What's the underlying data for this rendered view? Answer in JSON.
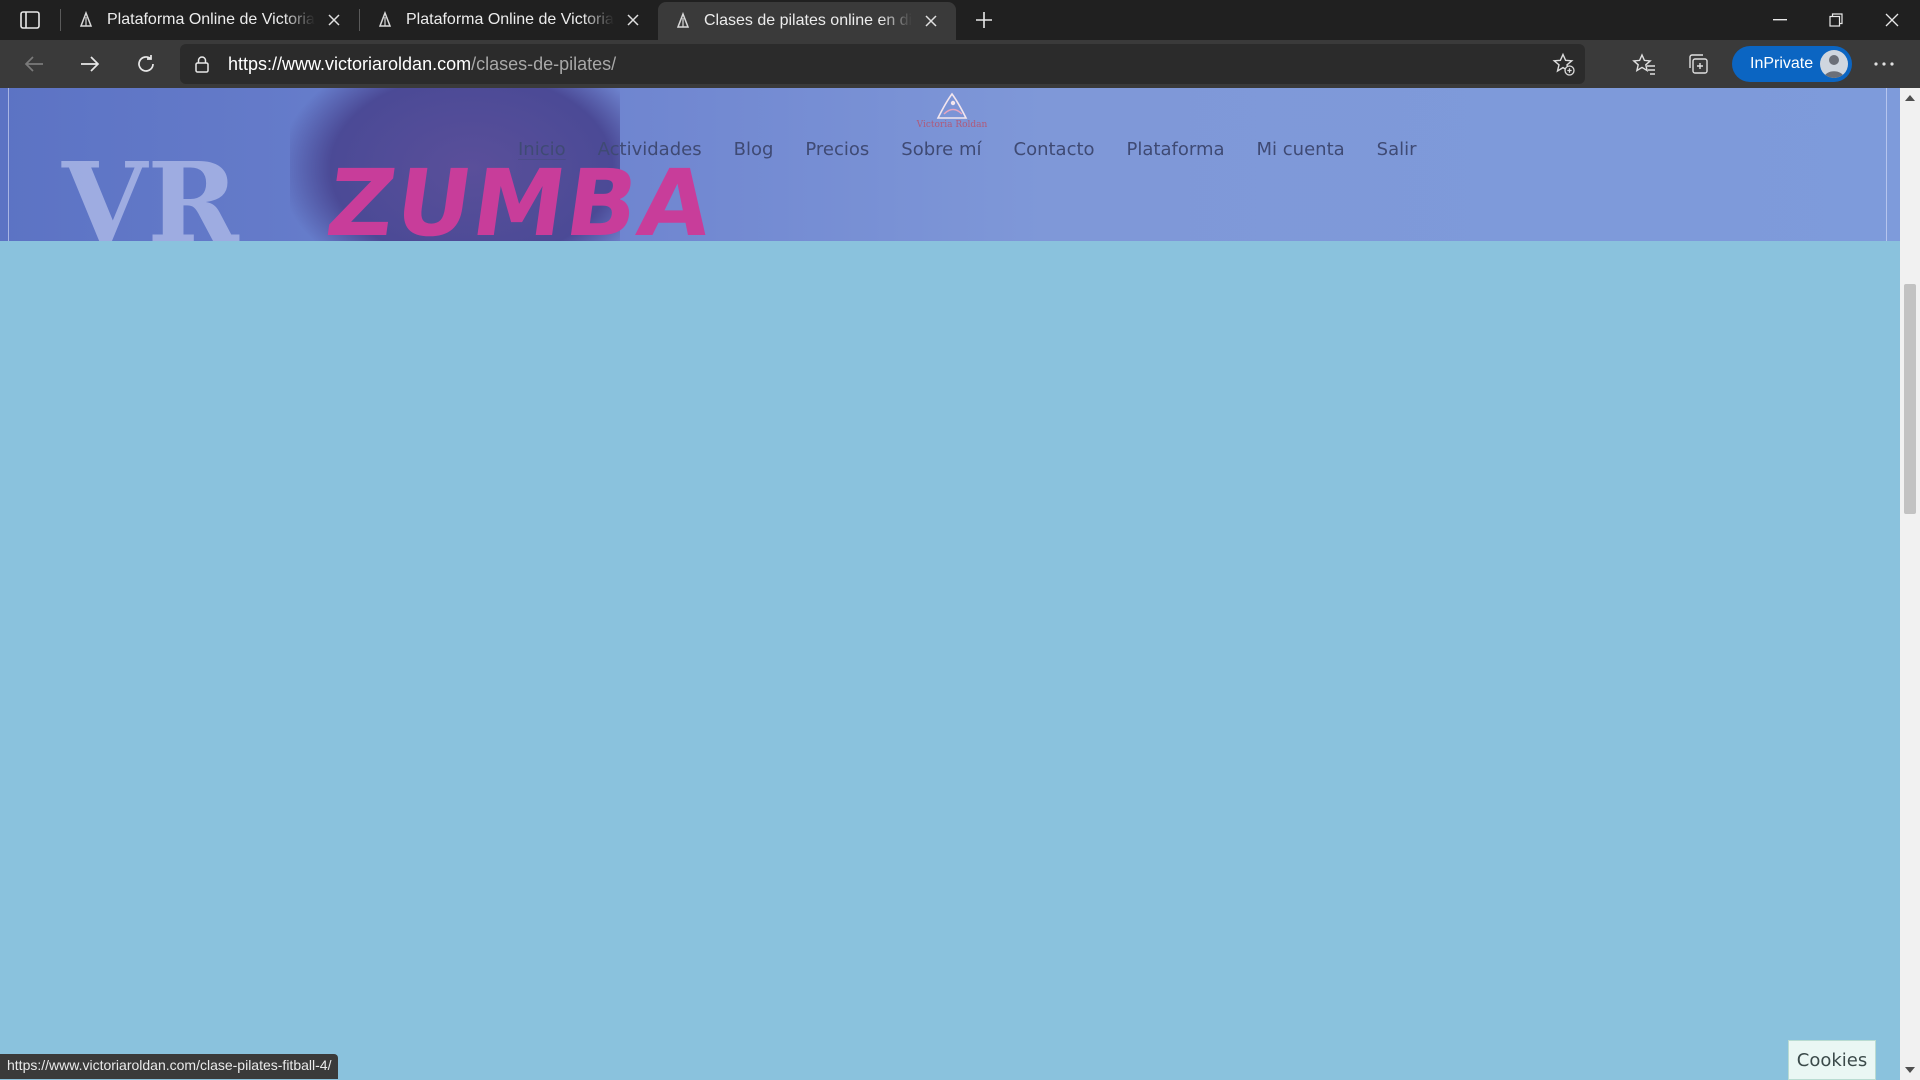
{
  "browser": {
    "tabs": [
      {
        "title": "Plataforma Online de Victoria Roldán",
        "active": false
      },
      {
        "title": "Plataforma Online de Victoria Roldán",
        "active": false
      },
      {
        "title": "Clases de pilates online en directo",
        "active": true
      }
    ],
    "url_host": "https://www.victoriaroldan.com",
    "url_path": "/clases-de-pilates/",
    "inprivate_label": "InPrivate",
    "status_url": "https://www.victoriaroldan.com/clase-pilates-fitball-4/"
  },
  "site": {
    "logo_text": "Victoria Roldan",
    "hero_text": "ZUMBA",
    "hero_mark": "VR",
    "menu": [
      {
        "label": "Inicio",
        "current": true
      },
      {
        "label": "Actividades"
      },
      {
        "label": "Blog"
      },
      {
        "label": "Precios"
      },
      {
        "label": "Sobre mí"
      },
      {
        "label": "Contacto"
      },
      {
        "label": "Plataforma"
      },
      {
        "label": "Mi cuenta"
      },
      {
        "label": "Salir"
      }
    ],
    "cookies_label": "Cookies"
  },
  "colors": {
    "page_background": "#8ac2dd",
    "accent_inprivate": "#0b65c2",
    "menu_text": "#3f4a74"
  }
}
